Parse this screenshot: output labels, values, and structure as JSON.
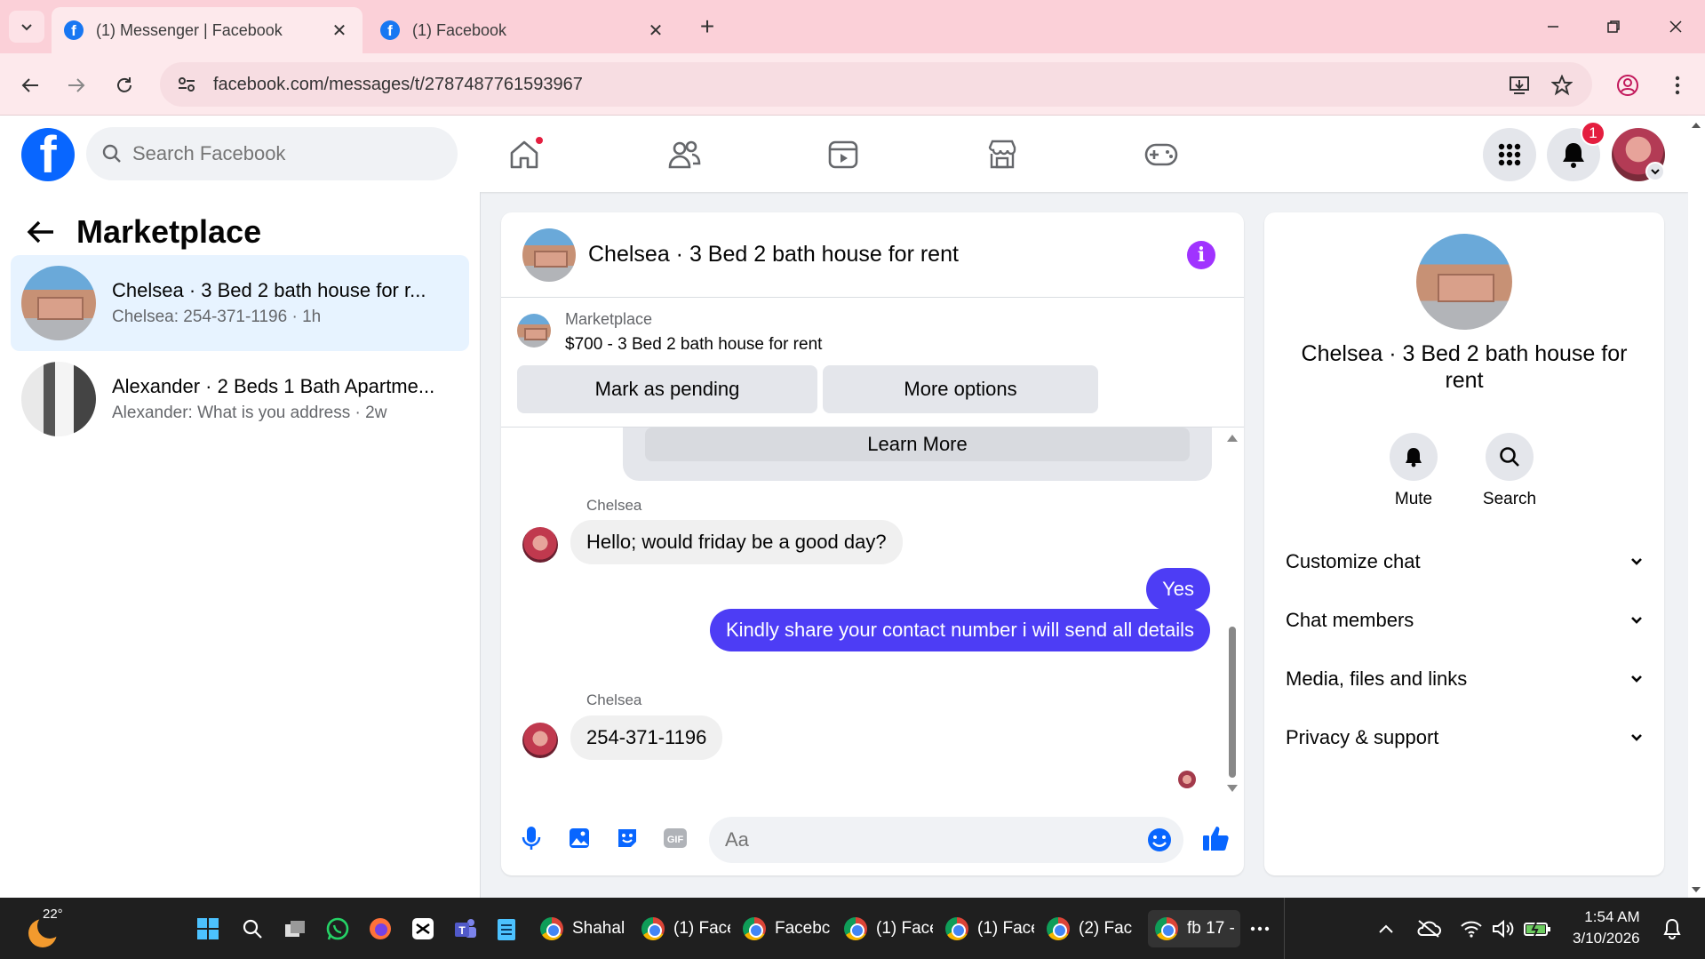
{
  "browser": {
    "tabs": [
      {
        "title": "(1) Messenger | Facebook",
        "active": true
      },
      {
        "title": "(1) Facebook",
        "active": false
      }
    ],
    "url": "facebook.com/messages/t/2787487761593967"
  },
  "fb_header": {
    "search_placeholder": "Search Facebook",
    "notification_count": "1",
    "nav_icons": [
      "home-icon",
      "friends-icon",
      "video-icon",
      "marketplace-icon",
      "gaming-icon"
    ]
  },
  "left_panel": {
    "title": "Marketplace",
    "conversations": [
      {
        "name": "Chelsea · 3 Bed 2 bath house for r...",
        "preview": "Chelsea: 254-371-1196 · 1h",
        "active": true
      },
      {
        "name": "Alexander · 2 Beds 1 Bath Apartme...",
        "preview": "Alexander: What is you address · 2w",
        "active": false
      }
    ]
  },
  "chat": {
    "title": "Chelsea · 3 Bed 2 bath house for rent",
    "marketplace_label": "Marketplace",
    "listing": "$700 - 3 Bed 2 bath house for rent",
    "buttons": {
      "mark_pending": "Mark as pending",
      "more_options": "More options"
    },
    "learn_more": "Learn More",
    "messages": [
      {
        "sender": "Chelsea",
        "text": "Hello; would friday be a good day?",
        "direction": "in"
      },
      {
        "text": "Yes",
        "direction": "out"
      },
      {
        "text": "Kindly share your contact number i will send all details",
        "direction": "out"
      },
      {
        "sender": "Chelsea",
        "text": "254-371-1196",
        "direction": "in"
      }
    ],
    "composer_placeholder": "Aa"
  },
  "right_panel": {
    "title": "Chelsea · 3 Bed 2 bath house for rent",
    "actions": [
      "Mute",
      "Search"
    ],
    "sections": [
      "Customize chat",
      "Chat members",
      "Media, files and links",
      "Privacy & support"
    ]
  },
  "taskbar": {
    "weather_temp": "22°",
    "apps": [
      "Shahal",
      "(1) Face",
      "Facebc",
      "(1) Face",
      "(1) Face",
      "(2) Fac",
      "fb 17 -"
    ],
    "time": "1:54 AM",
    "date": "3/10/2026"
  },
  "colors": {
    "fb_blue": "#0866ff",
    "outgoing_bubble": "#4d3df5",
    "tabbar": "#fbd0d8",
    "info_purple": "#a033ff"
  }
}
